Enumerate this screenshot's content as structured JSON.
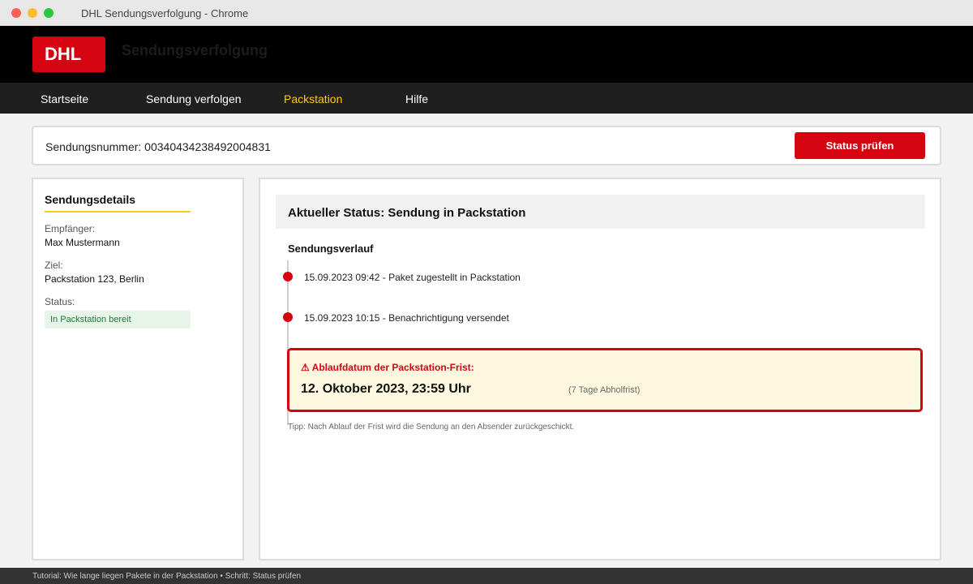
{
  "window": {
    "title": "DHL Sendungsverfolgung - Chrome"
  },
  "header": {
    "logo_text": "DHL",
    "title": "Sendungsverfolgung"
  },
  "nav": {
    "items": [
      {
        "label": "Startseite",
        "active": false
      },
      {
        "label": "Sendung verfolgen",
        "active": false
      },
      {
        "label": "Packstation",
        "active": true
      },
      {
        "label": "Hilfe",
        "active": false
      }
    ]
  },
  "search": {
    "label": "Sendungsnummer: 00340434238492004831",
    "button_label": "Status prüfen"
  },
  "details": {
    "heading": "Sendungsdetails",
    "recipient_label": "Empfänger:",
    "recipient_value": "Max Mustermann",
    "destination_label": "Ziel:",
    "destination_value": "Packstation 123, Berlin",
    "status_label": "Status:",
    "status_value": "In Packstation bereit"
  },
  "main": {
    "status_title": "Aktueller Status: Sendung in Packstation",
    "history_title": "Sendungsverlauf",
    "events": [
      {
        "text": "15.09.2023 09:42 - Paket zugestellt in Packstation"
      },
      {
        "text": "15.09.2023 10:15 - Benachrichtigung versendet"
      }
    ],
    "warning": {
      "icon": "warning-icon",
      "heading": "⚠ Ablaufdatum der Packstation-Frist:",
      "date": "12. Oktober 2023, 23:59 Uhr",
      "note": "(7 Tage Abholfrist)"
    },
    "tip": "Tipp: Nach Ablauf der Frist wird die Sendung an den Absender zurückgeschickt."
  },
  "footer": {
    "text": "Tutorial: Wie lange liegen Pakete in der Packstation • Schritt: Status prüfen"
  },
  "colors": {
    "brand_red": "#d40511",
    "brand_yellow": "#ffcc00",
    "status_green": "#1e7b34"
  }
}
